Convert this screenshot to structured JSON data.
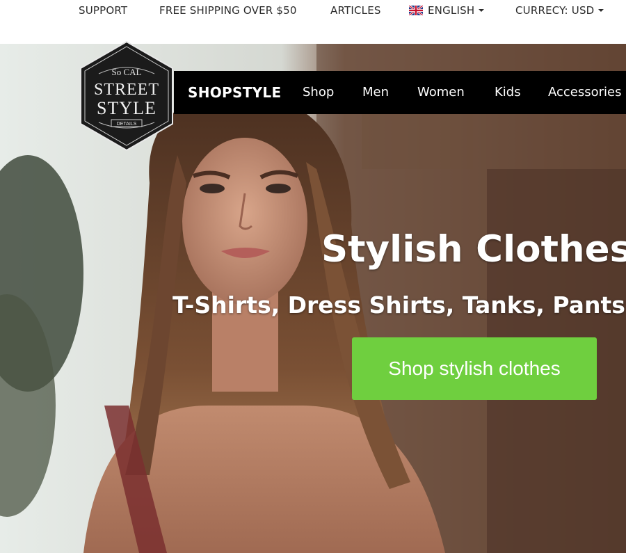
{
  "topbar": {
    "support": "SUPPORT",
    "shipping": "FREE SHIPPING OVER $50",
    "articles": "ARTICLES",
    "language": "ENGLISH",
    "currency": "CURRECY: USD",
    "language_flag_icon": "uk-flag-icon",
    "dropdown_icon": "caret-down-icon"
  },
  "logo": {
    "line1": "So CAL",
    "line2": "STREET",
    "line3": "STYLE",
    "line4": "DETAILS"
  },
  "nav": {
    "brand": "SHOPSTYLE",
    "items": [
      "Shop",
      "Men",
      "Women",
      "Kids",
      "Accessories"
    ]
  },
  "hero": {
    "headline": "Stylish Clothes",
    "subheadline": "T-Shirts, Dress Shirts, Tanks, Pants",
    "cta_label": "Shop stylish clothes"
  },
  "colors": {
    "cta": "#6fcf3f",
    "nav_bg": "#000000",
    "topbar_text": "#2b2b2b"
  }
}
